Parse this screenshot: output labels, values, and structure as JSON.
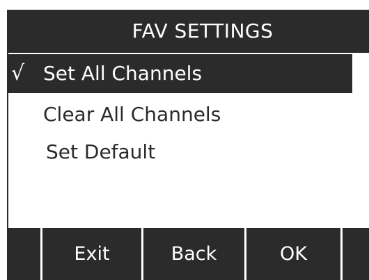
{
  "title_bar": {
    "title": "FAV SETTINGS"
  },
  "menu": {
    "items": [
      {
        "label": "Set All Channels",
        "checked": true,
        "selected": true,
        "check_glyph": "√"
      },
      {
        "label": "Clear All Channels",
        "checked": false,
        "selected": false
      },
      {
        "label": "Set Default",
        "checked": false,
        "selected": false
      }
    ]
  },
  "softkeys": {
    "exit_label": "Exit",
    "back_label": "Back",
    "ok_label": "OK"
  },
  "colors": {
    "bar_background": "#2b2b2b",
    "screen_background": "#ffffff",
    "text_dark": "#2a2a2a",
    "text_light": "#ffffff"
  },
  "icons": {
    "check": "checkmark-icon"
  }
}
